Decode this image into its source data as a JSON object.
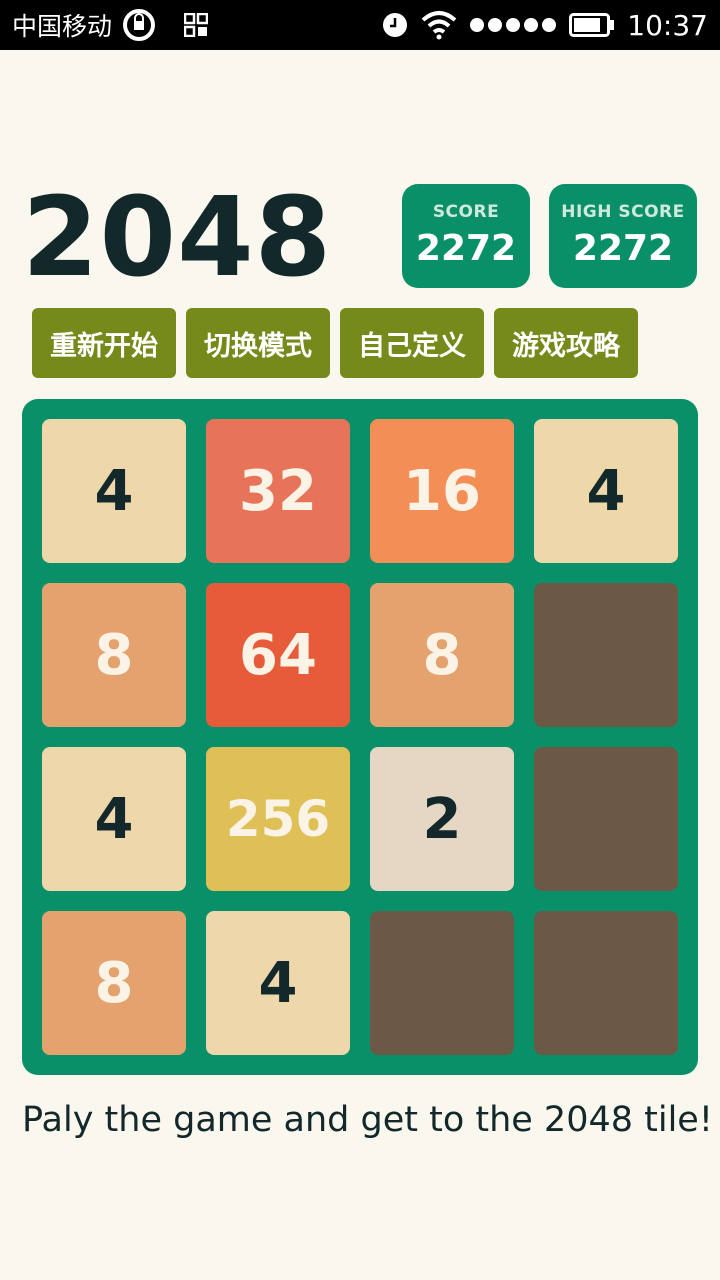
{
  "status_bar": {
    "carrier": "中国移动",
    "time": "10:37",
    "icons": [
      "sync-icon",
      "qr-icon",
      "clock-icon",
      "wifi-icon",
      "signal-icon",
      "battery-icon"
    ]
  },
  "header": {
    "title": "2048",
    "score_label": "SCORE",
    "score_value": "2272",
    "high_score_label": "HIGH SCORE",
    "high_score_value": "2272"
  },
  "menu": {
    "restart": "重新开始",
    "switch_mode": "切换模式",
    "customize": "自己定义",
    "guide": "游戏攻略"
  },
  "board": {
    "rows": [
      [
        "4",
        "32",
        "16",
        "4"
      ],
      [
        "8",
        "64",
        "8",
        ""
      ],
      [
        "4",
        "256",
        "2",
        ""
      ],
      [
        "8",
        "4",
        "",
        ""
      ]
    ]
  },
  "colors": {
    "background": "#faf7ee",
    "board": "#0a9068",
    "button": "#758a1b",
    "empty_tile": "#6b5945",
    "tile_2": "#e6d6c4",
    "tile_4": "#eed7aa",
    "tile_8": "#e4a36e",
    "tile_16": "#f38e57",
    "tile_32": "#e77459",
    "tile_64": "#e65c3b",
    "tile_256": "#dfc057",
    "dark_text": "#13282a",
    "light_text": "#fbf3e6"
  },
  "footer": {
    "hint": "Paly the game and get to the 2048 tile!"
  }
}
